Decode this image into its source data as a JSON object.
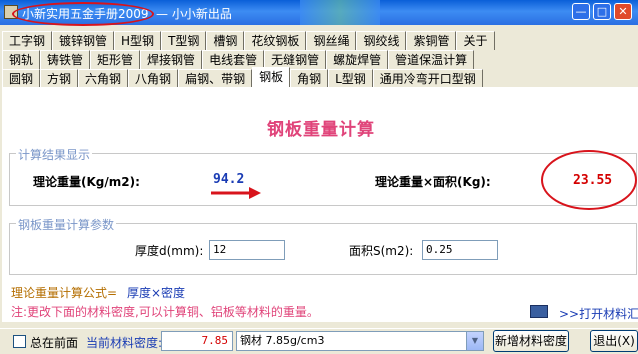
{
  "window": {
    "title_main": "小新实用五金手册2009",
    "title_rest": "— 小小新出品",
    "min_glyph": "—",
    "max_glyph": "□",
    "close_glyph": "✕"
  },
  "tabs": {
    "row1": [
      "工字钢",
      "镀锌钢管",
      "H型钢",
      "T型钢",
      "槽钢",
      "花纹钢板",
      "钢丝绳",
      "钢绞线",
      "紫铜管",
      "关于"
    ],
    "row2": [
      "钢轨",
      "铸铁管",
      "矩形管",
      "焊接钢管",
      "电线套管",
      "无缝钢管",
      "螺旋焊管",
      "管道保温计算"
    ],
    "row3": [
      "圆钢",
      "方钢",
      "六角钢",
      "八角钢",
      "扁钢、带钢",
      "钢板",
      "角钢",
      "L型钢",
      "通用冷弯开口型钢"
    ],
    "active": "钢板"
  },
  "main": {
    "heading": "钢板重量计算",
    "result_group": {
      "legend": "计算结果显示",
      "theory_weight_label": "理论重量(Kg/m2):",
      "theory_weight_value": "94.2",
      "weight_area_label": "理论重量×面积(Kg):",
      "weight_area_value": "23.55"
    },
    "param_group": {
      "legend": "钢板重量计算参数",
      "thickness_label": "厚度d(mm):",
      "thickness_value": "12",
      "area_label": "面积S(m2):",
      "area_value": "0.25"
    },
    "formula_label": "理论重量计算公式=",
    "formula_expr": "厚度×密度",
    "note": "注:更改下面的材料密度,可以计算铜、铝板等材料的重量。",
    "open_calc_link": ">>打开材料汇总"
  },
  "bottom": {
    "on_top_label": "总在前面",
    "on_top_checked": false,
    "density_label": "当前材料密度:",
    "density_value": "7.85",
    "material_select": "钢材 7.85g/cm3",
    "add_density_button": "新增材料密度",
    "exit_button": "退出(X)"
  },
  "colors": {
    "titlebar": "#2a6fe2",
    "heading": "#e0447a",
    "value_blue": "#1a3cb4",
    "value_red": "#d40000",
    "annotation_red": "#d8141c",
    "legend": "#7a96c8"
  }
}
